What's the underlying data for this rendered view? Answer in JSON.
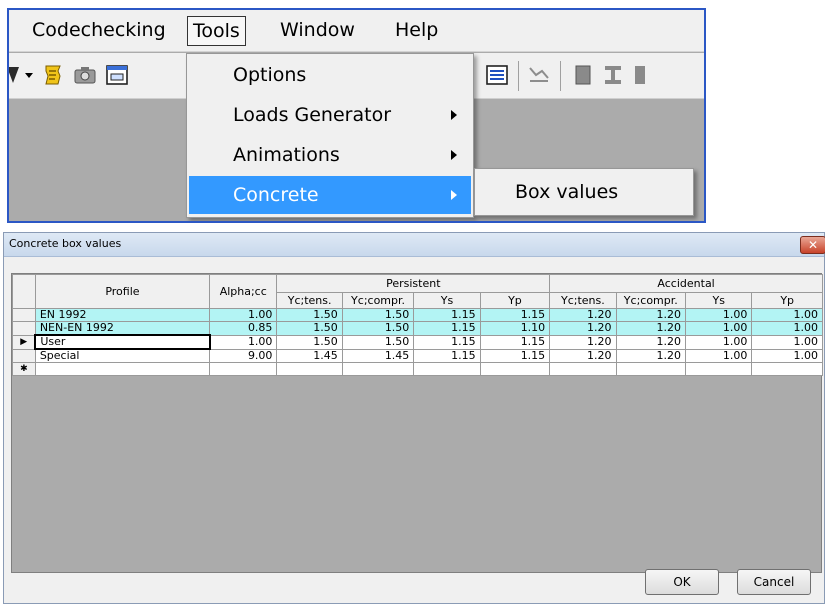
{
  "menubar": {
    "items": [
      "Codechecking",
      "Tools",
      "Window",
      "Help"
    ]
  },
  "tools_menu": {
    "items": [
      {
        "label": "Options",
        "has_submenu": false
      },
      {
        "label": "Loads Generator",
        "has_submenu": true
      },
      {
        "label": "Animations",
        "has_submenu": true
      },
      {
        "label": "Concrete",
        "has_submenu": true
      }
    ],
    "highlighted": "Concrete"
  },
  "concrete_submenu": {
    "items": [
      "Box values"
    ]
  },
  "dialog": {
    "title": "Concrete box values",
    "close_glyph": "✕",
    "columns": {
      "profile": "Profile",
      "alpha": "Alpha;cc",
      "persistent": "Persistent",
      "accidental": "Accidental",
      "sub": [
        "Yc;tens.",
        "Yc;compr.",
        "Ys",
        "Yp"
      ]
    },
    "rows": [
      {
        "marker": "",
        "profile": "EN 1992",
        "values": [
          "1.00",
          "1.50",
          "1.50",
          "1.15",
          "1.15",
          "1.20",
          "1.20",
          "1.00",
          "1.00"
        ],
        "highlight": true
      },
      {
        "marker": "",
        "profile": "NEN-EN 1992",
        "values": [
          "0.85",
          "1.50",
          "1.50",
          "1.15",
          "1.10",
          "1.20",
          "1.20",
          "1.00",
          "1.00"
        ],
        "highlight": true
      },
      {
        "marker": "▶",
        "profile": "User",
        "values": [
          "1.00",
          "1.50",
          "1.50",
          "1.15",
          "1.15",
          "1.20",
          "1.20",
          "1.00",
          "1.00"
        ],
        "highlight": false
      },
      {
        "marker": "",
        "profile": "Special",
        "values": [
          "9.00",
          "1.45",
          "1.45",
          "1.15",
          "1.15",
          "1.20",
          "1.20",
          "1.00",
          "1.00"
        ],
        "highlight": false
      },
      {
        "marker": "✱",
        "profile": "",
        "values": [
          "",
          "",
          "",
          "",
          "",
          "",
          "",
          "",
          ""
        ],
        "highlight": false
      }
    ],
    "ok_label": "OK",
    "cancel_label": "Cancel"
  }
}
